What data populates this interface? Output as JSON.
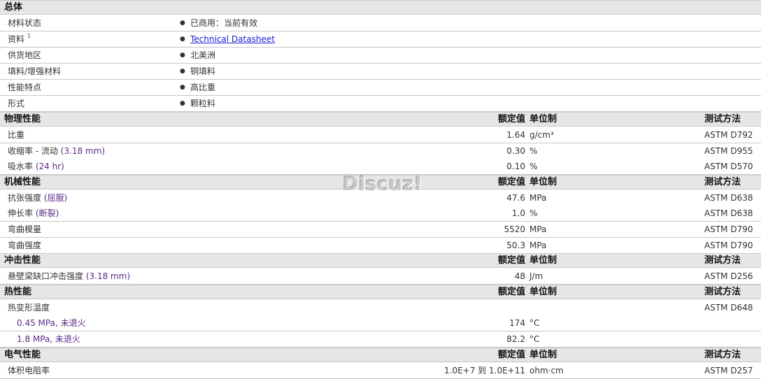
{
  "general": {
    "title": "总体",
    "rows": [
      {
        "label": "材料状态",
        "value": "已商用：当前有效"
      },
      {
        "label": "资料",
        "sup": "1",
        "value": "Technical Datasheet",
        "link": true
      },
      {
        "label": "供货地区",
        "value": "北美洲"
      },
      {
        "label": "填料/增强材料",
        "value": "铜填料"
      },
      {
        "label": "性能特点",
        "value": "高比重"
      },
      {
        "label": "形式",
        "value": "颗粒料"
      }
    ]
  },
  "columns": {
    "nominal": "额定值",
    "unit": "单位制",
    "method": "测试方法"
  },
  "sections": [
    {
      "title": "物理性能",
      "rows": [
        {
          "label": "比重",
          "cond": "",
          "value": "1.64",
          "unit": "g/cm³",
          "method": "ASTM D792"
        },
        {
          "label": "收缩率 - 流动",
          "cond": "(3.18 mm)",
          "value": "0.30",
          "unit": "%",
          "method": "ASTM D955"
        },
        {
          "label": "吸水率",
          "cond": "(24 hr)",
          "value": "0.10",
          "unit": "%",
          "method": "ASTM D570"
        }
      ]
    },
    {
      "title": "机械性能",
      "rows": [
        {
          "label": "抗张强度",
          "cond": "(屈服)",
          "value": "47.6",
          "unit": "MPa",
          "method": "ASTM D638"
        },
        {
          "label": "伸长率",
          "cond": "(断裂)",
          "value": "1.0",
          "unit": "%",
          "method": "ASTM D638"
        },
        {
          "label": "弯曲模量",
          "cond": "",
          "value": "5520",
          "unit": "MPa",
          "method": "ASTM D790"
        },
        {
          "label": "弯曲强度",
          "cond": "",
          "value": "50.3",
          "unit": "MPa",
          "method": "ASTM D790"
        }
      ]
    },
    {
      "title": "冲击性能",
      "rows": [
        {
          "label": "悬壁梁缺口冲击强度",
          "cond": "(3.18 mm)",
          "value": "48",
          "unit": "J/m",
          "method": "ASTM D256"
        }
      ]
    },
    {
      "title": "热性能",
      "rows": [
        {
          "label": "热变形温度",
          "cond": "",
          "value": "",
          "unit": "",
          "method": "ASTM D648"
        },
        {
          "label": "0.45 MPa, 未退火",
          "sub": true,
          "cond": "",
          "value": "174",
          "unit": "°C",
          "method": ""
        },
        {
          "label": "1.8 MPa, 未退火",
          "sub": true,
          "cond": "",
          "value": "82.2",
          "unit": "°C",
          "method": ""
        }
      ]
    },
    {
      "title": "电气性能",
      "rows": [
        {
          "label": "体积电阻率",
          "cond": "",
          "value": "1.0E+7 到  1.0E+11",
          "unit": "ohm·cm",
          "method": "ASTM D257"
        }
      ]
    }
  ],
  "watermark": "Discuz!"
}
